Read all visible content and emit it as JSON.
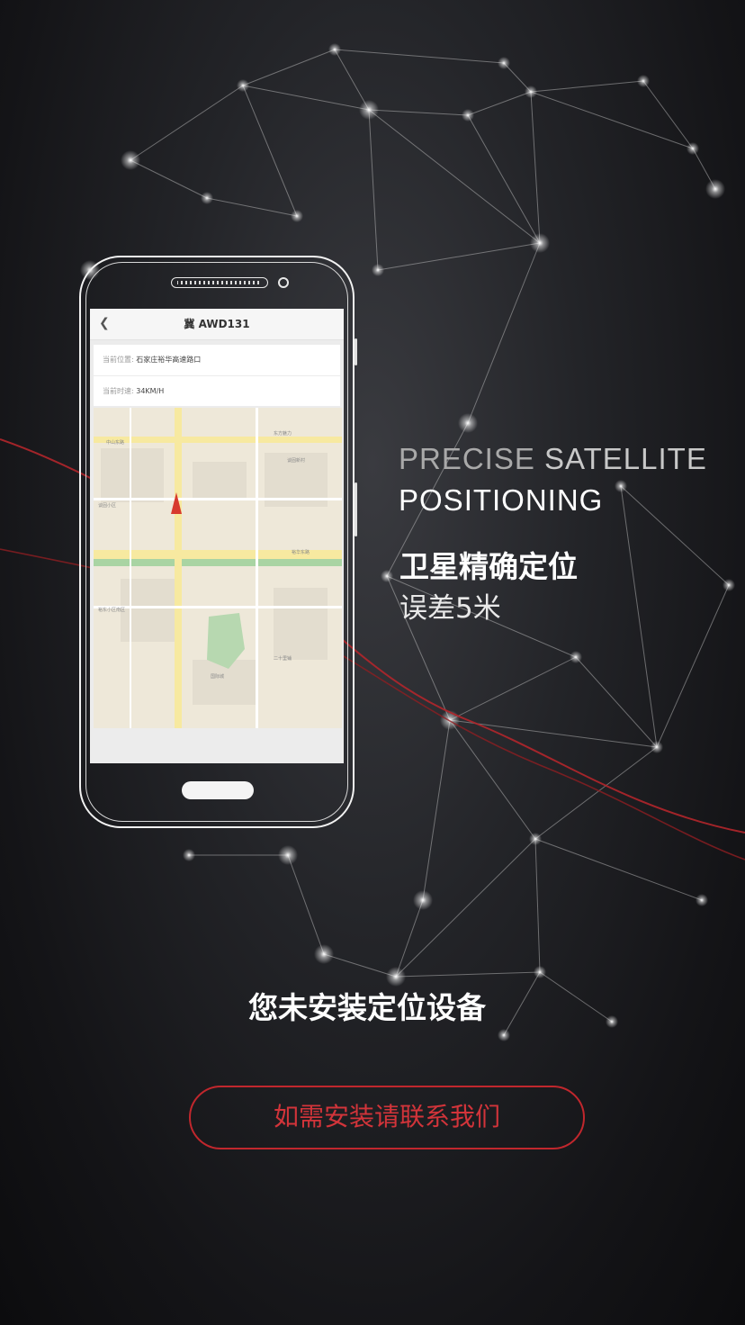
{
  "phone": {
    "screen_title": "冀 AWD131",
    "back_icon": "chevron-left-icon",
    "location_label": "当前位置:",
    "location_value": "石家庄裕华高速路口",
    "speed_label": "当前时速:",
    "speed_value": "34KM/H",
    "map_marker_icon": "navigation-arrow-icon"
  },
  "tagline": {
    "en_part1": "PRECISE",
    "en_part2": "SATELLITE",
    "en_line2": "POSITIONING",
    "cn_title": "卫星精确定位",
    "cn_sub": "误差5米"
  },
  "message": "您未安装定位设备",
  "contact_button": "如需安装请联系我们",
  "colors": {
    "accent": "#c1272d",
    "background": "#1c1c20"
  }
}
